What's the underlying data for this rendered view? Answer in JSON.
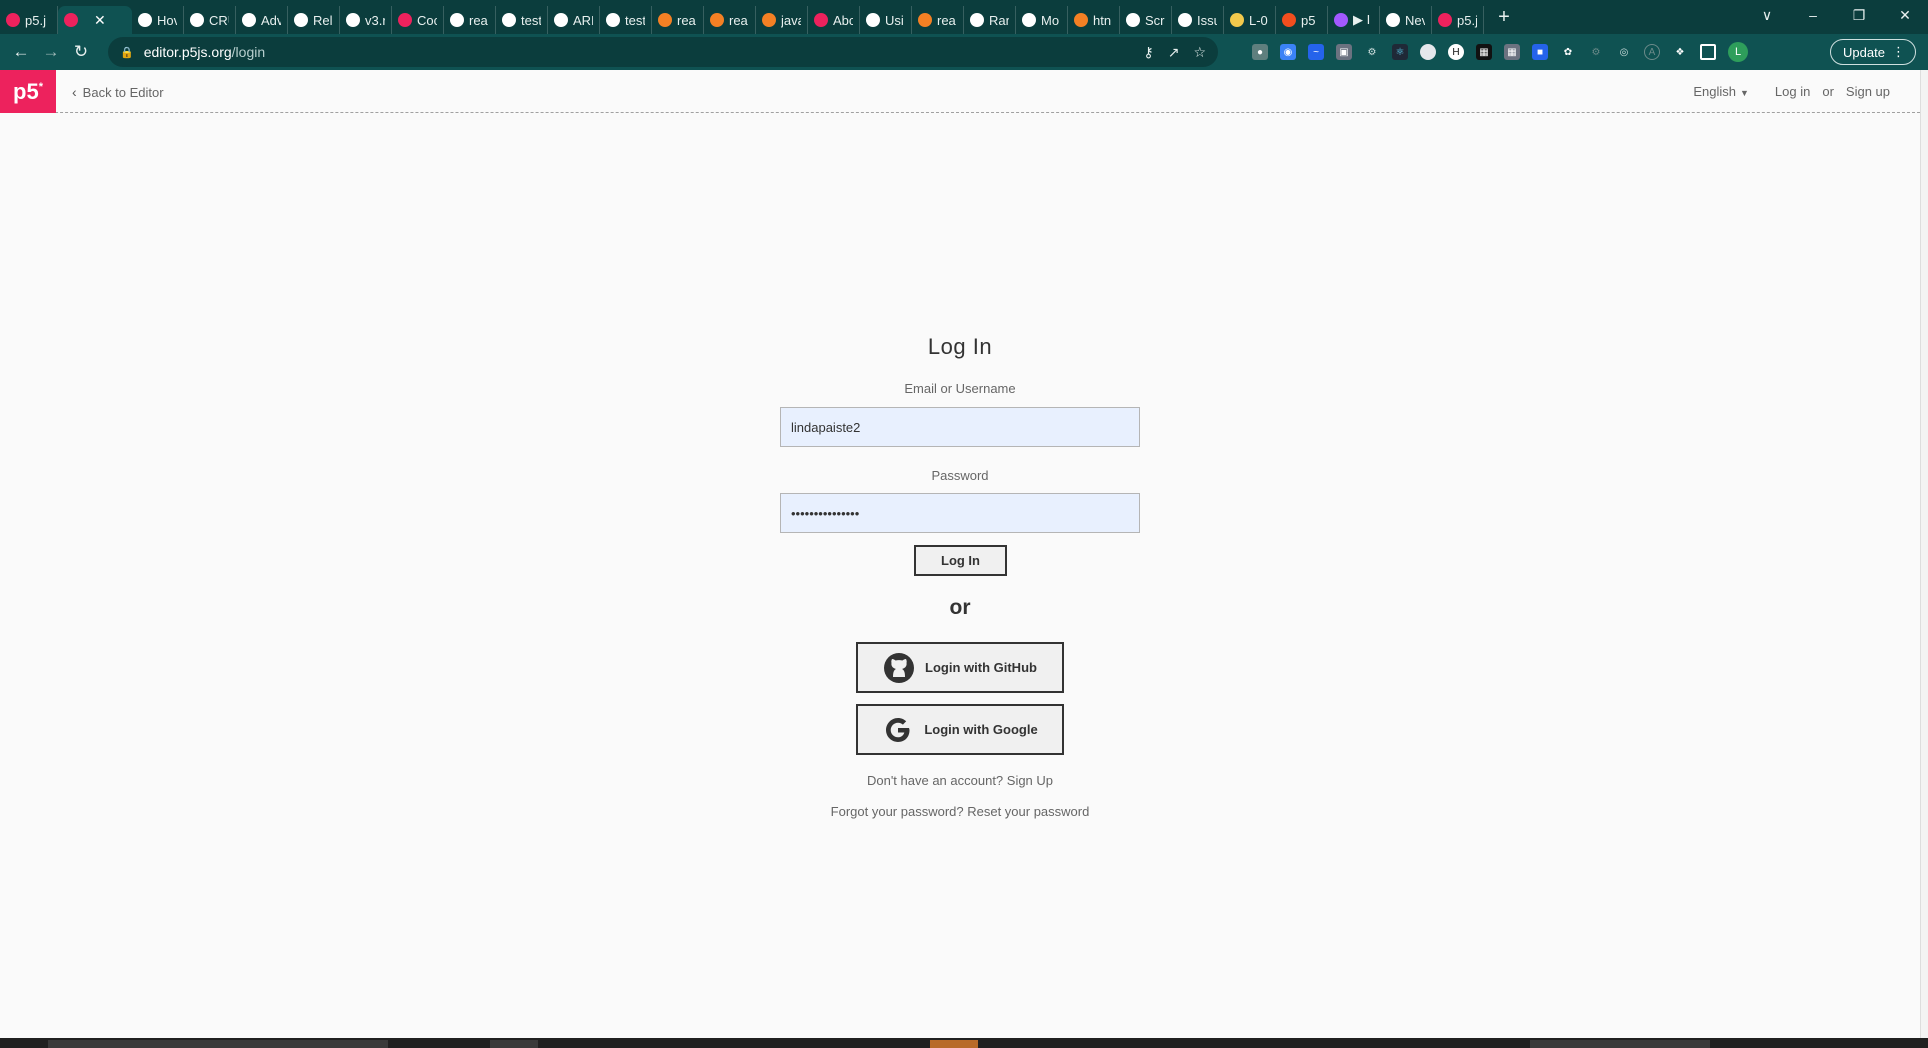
{
  "browser": {
    "tabs": [
      {
        "label": "p5.j",
        "icon": "p5-star-icon",
        "color": "#ed225d"
      },
      {
        "label": "",
        "icon": "p5-star-icon",
        "color": "#ed225d",
        "active": true
      },
      {
        "label": "Hov",
        "icon": "vercel-icon",
        "color": "#ffffff"
      },
      {
        "label": "CRU",
        "icon": "prisma-icon",
        "color": "#ffffff"
      },
      {
        "label": "Adv",
        "icon": "prisma-icon",
        "color": "#ffffff"
      },
      {
        "label": "Rel",
        "icon": "prisma-icon",
        "color": "#ffffff"
      },
      {
        "label": "v3.r",
        "icon": "globe-icon",
        "color": "#ffffff"
      },
      {
        "label": "Coc",
        "icon": "bug-icon",
        "color": "#ed225d"
      },
      {
        "label": "rea",
        "icon": "google-icon",
        "color": "#ffffff"
      },
      {
        "label": "test",
        "icon": "github-icon",
        "color": "#ffffff"
      },
      {
        "label": "ARI",
        "icon": "medium-icon",
        "color": "#ffffff"
      },
      {
        "label": "test",
        "icon": "google-icon",
        "color": "#ffffff"
      },
      {
        "label": "rea",
        "icon": "stackoverflow-icon",
        "color": "#f48024"
      },
      {
        "label": "rea",
        "icon": "stackoverflow-icon",
        "color": "#f48024"
      },
      {
        "label": "java",
        "icon": "stackoverflow-icon",
        "color": "#f48024"
      },
      {
        "label": "Abc",
        "icon": "bug-icon",
        "color": "#ed225d"
      },
      {
        "label": "Usi",
        "icon": "medium-icon",
        "color": "#ffffff"
      },
      {
        "label": "rea",
        "icon": "stackoverflow-icon",
        "color": "#f48024"
      },
      {
        "label": "Ran",
        "icon": "github-icon",
        "color": "#ffffff"
      },
      {
        "label": "Mo",
        "icon": "github-icon",
        "color": "#ffffff"
      },
      {
        "label": "htn",
        "icon": "stackoverflow-icon",
        "color": "#f48024"
      },
      {
        "label": "Scr",
        "icon": "globe-icon",
        "color": "#ffffff"
      },
      {
        "label": "Issu",
        "icon": "github-icon",
        "color": "#ffffff"
      },
      {
        "label": "L-0",
        "icon": "leaf-icon",
        "color": "#f2c94c"
      },
      {
        "label": "p5",
        "icon": "figma-icon",
        "color": "#f24e1e"
      },
      {
        "label": "▶ I",
        "icon": "figma-icon",
        "color": "#a259ff"
      },
      {
        "label": "Nev",
        "icon": "github-icon",
        "color": "#ffffff"
      },
      {
        "label": "p5.j",
        "icon": "p5-star-icon",
        "color": "#ed225d"
      }
    ],
    "close_glyph": "✕",
    "new_tab_glyph": "+",
    "window_controls": [
      "∨",
      "–",
      "❐",
      "✕"
    ],
    "url_host": "editor.p5js.org",
    "url_path": "/login",
    "update_label": "Update",
    "profile_initial": "L"
  },
  "header": {
    "logo_text": "p5",
    "logo_mark": "*",
    "back_label": "Back to Editor",
    "language": "English",
    "login_label": "Log in",
    "or_label": "or",
    "signup_label": "Sign up"
  },
  "form": {
    "title": "Log In",
    "email_label": "Email or Username",
    "email_value": "lindapaiste2",
    "password_label": "Password",
    "password_value": "•••••••••••••••",
    "submit_label": "Log In",
    "or_text": "or",
    "github_label": "Login with GitHub",
    "google_label": "Login with Google",
    "signup_prompt": "Don't have an account? Sign Up",
    "reset_prompt": "Forgot your password? Reset your password"
  },
  "colors": {
    "brand": "#ed225d",
    "chrome_dark": "#0b3d3d",
    "chrome_toolbar": "#0f5252",
    "autofill": "#e8f0fe"
  }
}
